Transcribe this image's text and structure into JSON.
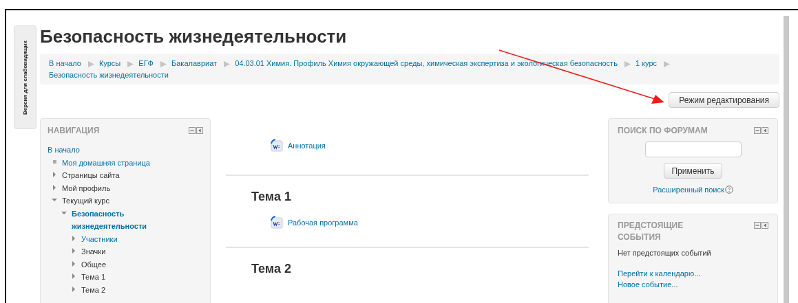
{
  "side_tab": "Версия для слабовидящих",
  "title": "Безопасность жизнедеятельности",
  "breadcrumb": [
    "В начало",
    "Курсы",
    "ЕГФ",
    "Бакалавриат",
    "04.03.01 Химия. Профиль Химия окружающей среды, химическая экспертиза и экологическая безопасность",
    "1 курс",
    "Безопасность жизнедеятельности"
  ],
  "edit_button": "Режим редактирования",
  "navigation": {
    "title": "НАВИГАЦИЯ",
    "items": [
      {
        "label": "В начало",
        "link": true,
        "children": [
          {
            "label": "Моя домашняя страница",
            "kind": "leaf",
            "link": true
          },
          {
            "label": "Страницы сайта",
            "kind": "branch",
            "expanded": false,
            "link": false
          },
          {
            "label": "Мой профиль",
            "kind": "branch",
            "expanded": false,
            "link": false
          },
          {
            "label": "Текущий курс",
            "kind": "branch",
            "expanded": true,
            "link": false,
            "children": [
              {
                "label": "Безопасность жизнедеятельности",
                "kind": "branch",
                "expanded": true,
                "link": true,
                "current": true,
                "children": [
                  {
                    "label": "Участники",
                    "kind": "branch",
                    "expanded": false,
                    "link": true
                  },
                  {
                    "label": "Значки",
                    "kind": "branch",
                    "expanded": false,
                    "link": false
                  },
                  {
                    "label": "Общее",
                    "kind": "branch",
                    "expanded": false,
                    "link": false
                  },
                  {
                    "label": "Тема 1",
                    "kind": "branch",
                    "expanded": false,
                    "link": false
                  },
                  {
                    "label": "Тема 2",
                    "kind": "branch",
                    "expanded": false,
                    "link": false
                  }
                ]
              }
            ]
          }
        ]
      }
    ]
  },
  "sections": [
    {
      "activities": [
        "Аннотация"
      ]
    },
    {
      "title": "Тема 1",
      "activities": [
        "Рабочая программа"
      ]
    },
    {
      "title": "Тема 2"
    }
  ],
  "forum_search": {
    "title": "ПОИСК ПО ФОРУМАМ",
    "button": "Применить",
    "advanced_link": "Расширенный поиск"
  },
  "events": {
    "title": "ПРЕДСТОЯЩИЕ СОБЫТИЯ",
    "text": "Нет предстоящих событий",
    "links": [
      "Перейти к календарю...",
      "Новое событие..."
    ]
  }
}
